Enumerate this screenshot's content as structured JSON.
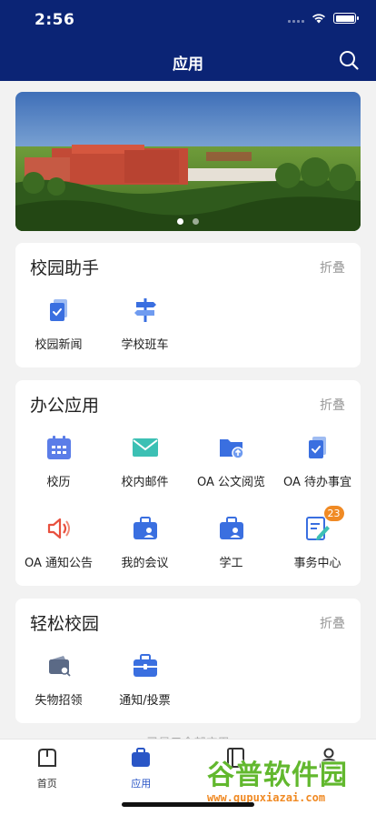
{
  "status": {
    "time": "2:56"
  },
  "header": {
    "title": "应用"
  },
  "sections": [
    {
      "title": "校园助手",
      "fold": "折叠",
      "items": [
        {
          "label": "校园新闻",
          "icon": "document-check-icon"
        },
        {
          "label": "学校班车",
          "icon": "signpost-icon"
        }
      ]
    },
    {
      "title": "办公应用",
      "fold": "折叠",
      "items": [
        {
          "label": "校历",
          "icon": "calendar-icon"
        },
        {
          "label": "校内邮件",
          "icon": "mail-icon"
        },
        {
          "label": "OA 公文阅览",
          "icon": "folder-upload-icon"
        },
        {
          "label": "OA 待办事宜",
          "icon": "document-check-icon"
        },
        {
          "label": "OA 通知公告",
          "icon": "speaker-icon"
        },
        {
          "label": "我的会议",
          "icon": "briefcase-user-icon"
        },
        {
          "label": "学工",
          "icon": "briefcase-user-icon"
        },
        {
          "label": "事务中心",
          "icon": "document-edit-icon",
          "badge": "23"
        }
      ]
    },
    {
      "title": "轻松校园",
      "fold": "折叠",
      "items": [
        {
          "label": "失物招领",
          "icon": "wallet-search-icon"
        },
        {
          "label": "通知/投票",
          "icon": "briefcase-icon"
        }
      ]
    }
  ],
  "more_hint": "已显示全部应用",
  "tabbar": [
    {
      "label": "首页",
      "icon": "home-icon"
    },
    {
      "label": "应用",
      "icon": "briefcase-icon",
      "active": true
    },
    {
      "label": "",
      "icon": "notebook-icon"
    },
    {
      "label": "",
      "icon": "user-icon"
    }
  ],
  "watermark": {
    "text": "谷普软件园",
    "url": "www.gupuxiazai.com"
  },
  "colors": {
    "header": "#0b2475",
    "icon_blue": "#3a6fe0",
    "badge": "#f08a24",
    "active_tab": "#2a56c6"
  }
}
